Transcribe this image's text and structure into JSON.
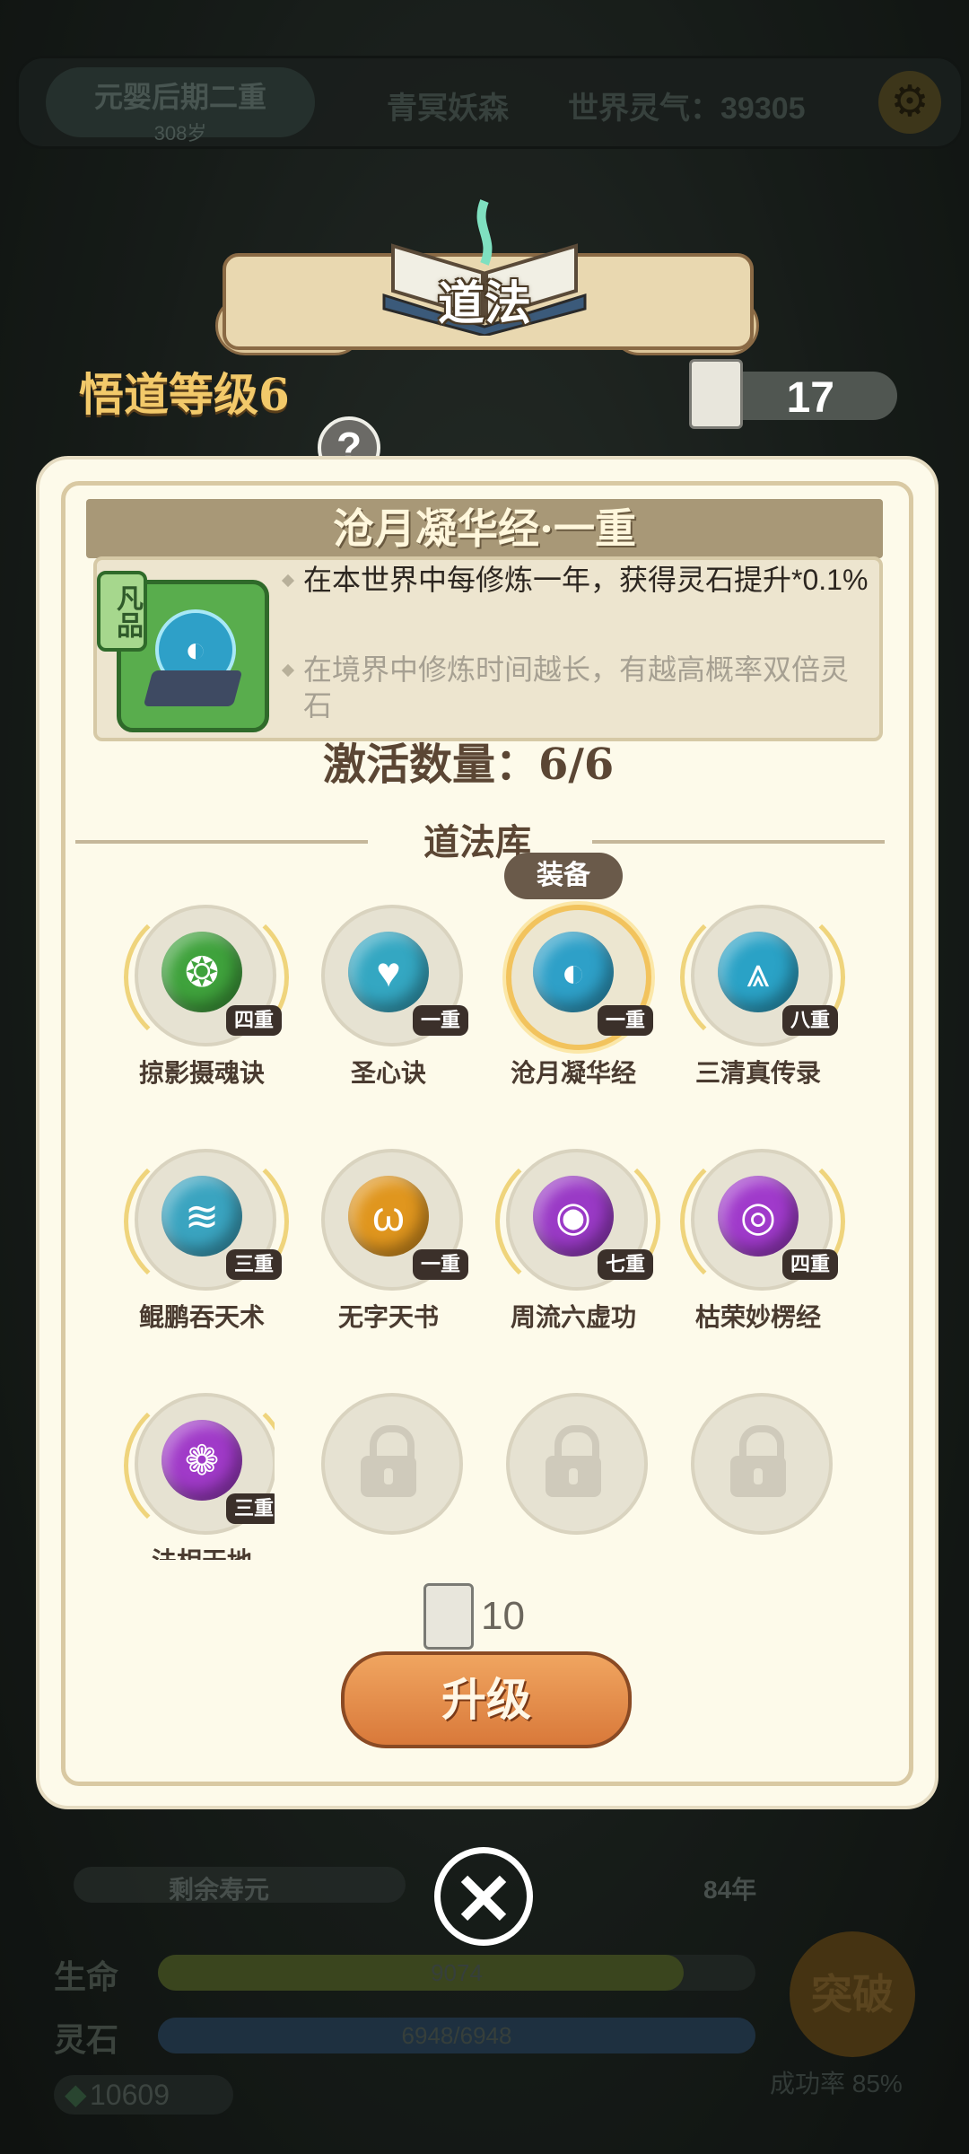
{
  "hud": {
    "realm": "元婴后期二重",
    "age": "308岁",
    "location": "青冥妖森",
    "world_qi": "世界灵气：39305"
  },
  "header": {
    "title": "道法",
    "wudao_level": "悟道等级6",
    "scroll_count": "17"
  },
  "selected_skill": {
    "title": "沧月凝华经·一重",
    "grade": "凡品",
    "desc1": "在本世界中每修炼一年，获得灵石提升*0.1%",
    "desc2": "在境界中修炼时间越长，有越高概率双倍灵石",
    "activate": "激活数量：6/6"
  },
  "library": {
    "title": "道法库",
    "equip_label": "装备",
    "skills": [
      {
        "name": "掠影摄魂诀",
        "level": "四重",
        "color": "#3fa23c"
      },
      {
        "name": "圣心诀",
        "level": "一重",
        "color": "#34a7c2"
      },
      {
        "name": "沧月凝华经",
        "level": "一重",
        "color": "#2ea0c8"
      },
      {
        "name": "三清真传录",
        "level": "八重",
        "color": "#2aa2c6"
      },
      {
        "name": "鲲鹏吞天术",
        "level": "三重",
        "color": "#3aa4c0"
      },
      {
        "name": "无字天书",
        "level": "一重",
        "color": "#e0961e"
      },
      {
        "name": "周流六虚功",
        "level": "七重",
        "color": "#9a3ac6"
      },
      {
        "name": "枯荣妙楞经",
        "level": "四重",
        "color": "#a03acb"
      },
      {
        "name": "法相天地",
        "level": "三重",
        "color": "#a03ac8"
      }
    ]
  },
  "upgrade": {
    "cost": "10",
    "button": "升级"
  },
  "bottom": {
    "life_remaining_label": "剩余寿元",
    "life_remaining_value": "84年",
    "hp_label": "生命",
    "hp_value": "9074",
    "stone_label": "灵石",
    "stone_value": "6948/6948",
    "stone_count": "10609",
    "breakthrough": "突破",
    "success_rate": "成功率 85%"
  }
}
